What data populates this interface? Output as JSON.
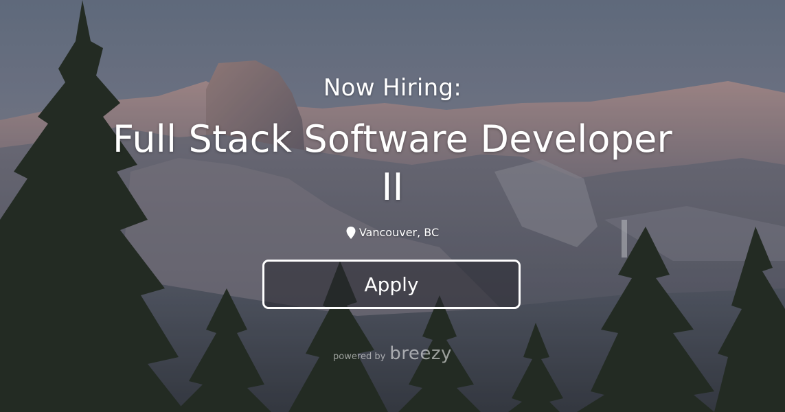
{
  "header": {
    "eyebrow": "Now Hiring:",
    "job_title": "Full Stack Software Developer II"
  },
  "location": {
    "icon": "map-pin-icon",
    "text": "Vancouver, BC"
  },
  "apply_label": "Apply",
  "footer": {
    "powered_by": "powered by",
    "brand": "breezy"
  },
  "colors": {
    "text": "#ffffff",
    "sky_top": "#6f7c91",
    "sky_bottom": "#c4a8a8"
  }
}
